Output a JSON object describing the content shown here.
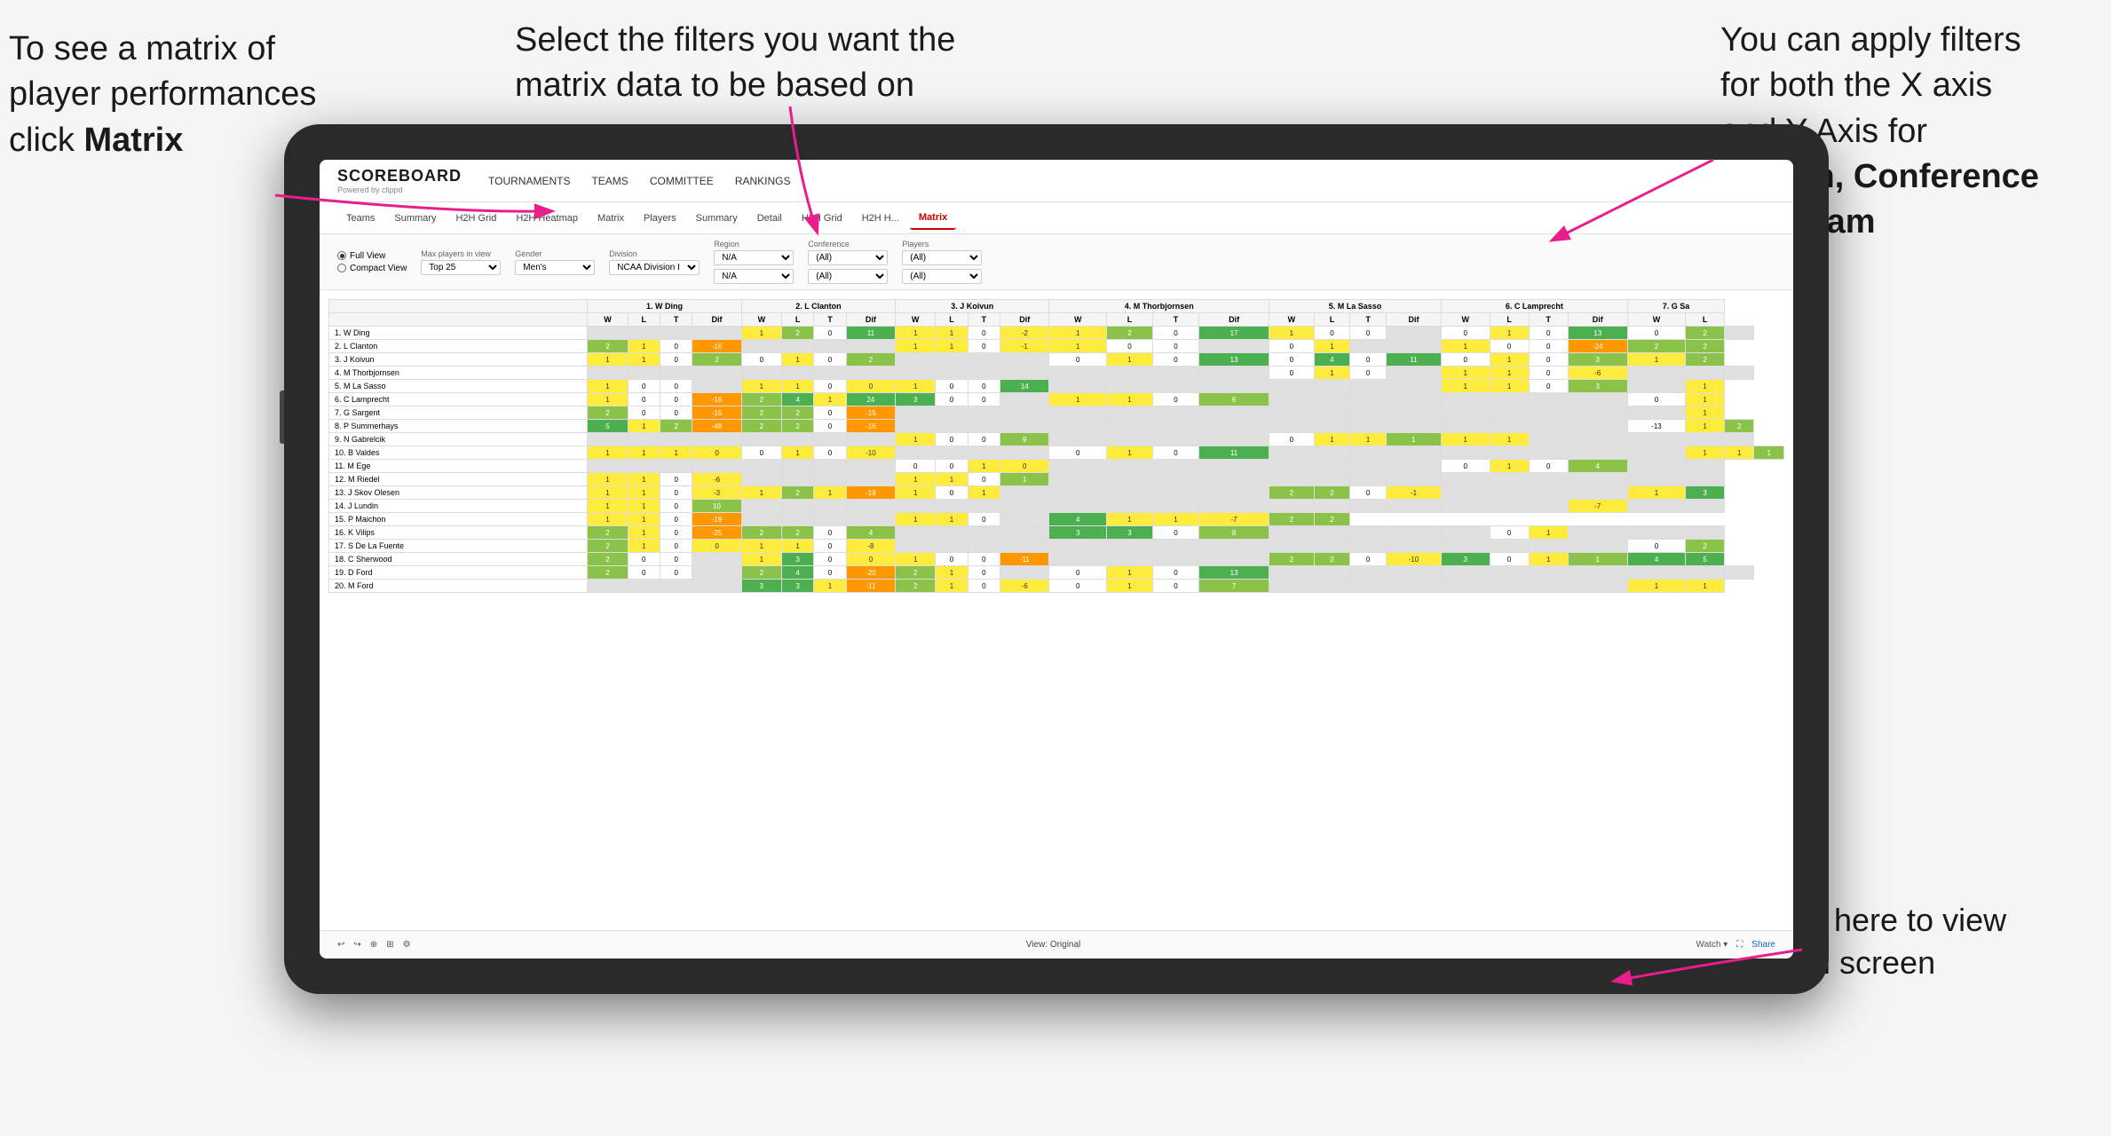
{
  "annotations": {
    "matrix_text": "To see a matrix of player performances click Matrix",
    "matrix_bold": "Matrix",
    "filters_text": "Select the filters you want the matrix data to be based on",
    "axes_text": "You  can apply filters for both the X axis and Y Axis for Region, Conference and Team",
    "axes_bold": "Region, Conference and Team",
    "fullscreen_text": "Click here to view in full screen"
  },
  "app": {
    "logo": "SCOREBOARD",
    "logo_sub": "Powered by clippd",
    "nav": [
      "TOURNAMENTS",
      "TEAMS",
      "COMMITTEE",
      "RANKINGS"
    ],
    "sub_nav": [
      "Teams",
      "Summary",
      "H2H Grid",
      "H2H Heatmap",
      "Matrix",
      "Players",
      "Summary",
      "Detail",
      "H2H Grid",
      "H2H H...",
      "Matrix"
    ],
    "active_tab": "Matrix"
  },
  "filters": {
    "view_full": "Full View",
    "view_compact": "Compact View",
    "max_players_label": "Max players in view",
    "max_players_value": "Top 25",
    "gender_label": "Gender",
    "gender_value": "Men's",
    "division_label": "Division",
    "division_value": "NCAA Division I",
    "region_label": "Region",
    "region_value": "N/A",
    "conference_label": "Conference",
    "conference_value": "(All)",
    "players_label": "Players",
    "players_value": "(All)"
  },
  "matrix": {
    "col_headers": [
      "1. W Ding",
      "2. L Clanton",
      "3. J Koivun",
      "4. M Thorbjornsen",
      "5. M La Sasso",
      "6. C Lamprecht",
      "7. G Sa"
    ],
    "sub_headers": [
      "W",
      "L",
      "T",
      "Dif"
    ],
    "rows": [
      {
        "name": "1. W Ding",
        "cells": [
          "",
          "",
          "",
          "",
          "1",
          "2",
          "0",
          "11",
          "1",
          "1",
          "0",
          "-2",
          "1",
          "2",
          "0",
          "17",
          "1",
          "0",
          "0",
          "",
          "0",
          "1",
          "0",
          "13",
          "0",
          "2",
          ""
        ]
      },
      {
        "name": "2. L Clanton",
        "cells": [
          "2",
          "1",
          "0",
          "-16",
          "",
          "",
          "",
          "",
          "1",
          "1",
          "0",
          "-1",
          "1",
          "0",
          "0",
          "",
          "0",
          "1",
          "",
          "",
          "1",
          "0",
          "0",
          "-24",
          "2",
          "2"
        ]
      },
      {
        "name": "3. J Koivun",
        "cells": [
          "1",
          "1",
          "0",
          "2",
          "0",
          "1",
          "0",
          "2",
          "",
          "",
          "",
          "",
          "0",
          "1",
          "0",
          "13",
          "0",
          "4",
          "0",
          "11",
          "0",
          "1",
          "0",
          "3",
          "1",
          "2"
        ]
      },
      {
        "name": "4. M Thorbjornsen",
        "cells": [
          "",
          "",
          "",
          "",
          "",
          "",
          "",
          "",
          "",
          "",
          "",
          "",
          "",
          "",
          "",
          "",
          "0",
          "1",
          "0",
          "",
          "1",
          "1",
          "0",
          "-6",
          "",
          "",
          ""
        ]
      },
      {
        "name": "5. M La Sasso",
        "cells": [
          "1",
          "0",
          "0",
          "",
          "1",
          "1",
          "0",
          "0",
          "1",
          "0",
          "0",
          "14",
          "",
          "",
          "",
          "",
          "",
          "",
          "",
          "",
          "1",
          "1",
          "0",
          "3",
          "",
          "1"
        ]
      },
      {
        "name": "6. C Lamprecht",
        "cells": [
          "1",
          "0",
          "0",
          "-16",
          "2",
          "4",
          "1",
          "24",
          "3",
          "0",
          "0",
          "",
          "1",
          "1",
          "0",
          "6",
          "",
          "",
          "",
          "",
          "",
          "",
          "",
          "",
          "0",
          "1"
        ]
      },
      {
        "name": "7. G Sargent",
        "cells": [
          "2",
          "0",
          "0",
          "-16",
          "2",
          "2",
          "0",
          "-15",
          "",
          "",
          "",
          "",
          "",
          "",
          "",
          "",
          "",
          "",
          "",
          "",
          "",
          "",
          "",
          "",
          "",
          "1"
        ]
      },
      {
        "name": "8. P Summerhays",
        "cells": [
          "5",
          "1",
          "2",
          "-48",
          "2",
          "2",
          "0",
          "-16",
          "",
          "",
          "",
          "",
          "",
          "",
          "",
          "",
          "",
          "",
          "",
          "",
          "",
          "",
          "",
          "",
          "-13",
          "1",
          "2"
        ]
      },
      {
        "name": "9. N Gabrelcik",
        "cells": [
          "",
          "",
          "",
          "",
          "",
          "",
          "",
          "",
          "1",
          "0",
          "0",
          "9",
          "",
          "",
          "",
          "",
          "0",
          "1",
          "1",
          "1",
          "1",
          "1",
          "",
          "",
          "",
          "",
          ""
        ]
      },
      {
        "name": "10. B Valdes",
        "cells": [
          "1",
          "1",
          "1",
          "0",
          "0",
          "1",
          "0",
          "-10",
          "",
          "",
          "",
          "",
          "0",
          "1",
          "0",
          "11",
          "",
          "",
          "",
          "",
          "",
          "",
          "",
          "",
          "",
          "1",
          "1",
          "1"
        ]
      },
      {
        "name": "11. M Ege",
        "cells": [
          "",
          "",
          "",
          "",
          "",
          "",
          "",
          "",
          "0",
          "0",
          "1",
          "0",
          "",
          "",
          "",
          "",
          "",
          "",
          "",
          "",
          "0",
          "1",
          "0",
          "4",
          "",
          ""
        ]
      },
      {
        "name": "12. M Riedel",
        "cells": [
          "1",
          "1",
          "0",
          "-6",
          "",
          "",
          "",
          "",
          "1",
          "1",
          "0",
          "1",
          "",
          "",
          "",
          "",
          "",
          "",
          "",
          "",
          "",
          "",
          "",
          "",
          "",
          ""
        ]
      },
      {
        "name": "13. J Skov Olesen",
        "cells": [
          "1",
          "1",
          "0",
          "-3",
          "1",
          "2",
          "1",
          "-19",
          "1",
          "0",
          "1",
          "",
          "",
          "",
          "",
          "",
          "2",
          "2",
          "0",
          "-1",
          "",
          "",
          "",
          "",
          "1",
          "3"
        ]
      },
      {
        "name": "14. J Lundin",
        "cells": [
          "1",
          "1",
          "0",
          "10",
          "",
          "",
          "",
          "",
          "",
          "",
          "",
          "",
          "",
          "",
          "",
          "",
          "",
          "",
          "",
          "",
          "",
          "",
          "",
          "-7",
          "",
          ""
        ]
      },
      {
        "name": "15. P Maichon",
        "cells": [
          "1",
          "1",
          "0",
          "-19",
          "",
          "",
          "",
          "",
          "1",
          "1",
          "0",
          "",
          "4",
          "1",
          "1",
          "-7",
          "2",
          "2"
        ]
      },
      {
        "name": "16. K Vilips",
        "cells": [
          "2",
          "1",
          "0",
          "-25",
          "2",
          "2",
          "0",
          "4",
          "",
          "",
          "",
          "",
          "3",
          "3",
          "0",
          "8",
          "",
          "",
          "",
          "",
          "",
          "0",
          "1",
          "",
          "",
          ""
        ]
      },
      {
        "name": "17. S De La Fuente",
        "cells": [
          "2",
          "1",
          "0",
          "0",
          "1",
          "1",
          "0",
          "-8",
          "",
          "",
          "",
          "",
          "",
          "",
          "",
          "",
          "",
          "",
          "",
          "",
          "",
          "",
          "",
          "",
          "0",
          "2"
        ]
      },
      {
        "name": "18. C Sherwood",
        "cells": [
          "2",
          "0",
          "0",
          "",
          "1",
          "3",
          "0",
          "0",
          "1",
          "0",
          "0",
          "-11",
          "",
          "",
          "",
          "",
          "2",
          "2",
          "0",
          "-10",
          "3",
          "0",
          "1",
          "1",
          "4",
          "5"
        ]
      },
      {
        "name": "19. D Ford",
        "cells": [
          "2",
          "0",
          "0",
          "",
          "2",
          "4",
          "0",
          "-20",
          "2",
          "1",
          "0",
          "",
          "0",
          "1",
          "0",
          "13",
          "",
          "",
          "",
          "",
          "",
          "",
          "",
          "",
          "",
          "",
          ""
        ]
      },
      {
        "name": "20. M Ford",
        "cells": [
          "",
          "",
          "",
          "",
          "3",
          "3",
          "1",
          "-11",
          "2",
          "1",
          "0",
          "-6",
          "0",
          "1",
          "0",
          "7",
          "",
          "",
          "",
          "",
          "",
          "",
          "",
          "",
          "1",
          "1"
        ]
      }
    ]
  },
  "bottom_bar": {
    "view_label": "View: Original",
    "watch_label": "Watch",
    "share_label": "Share"
  },
  "colors": {
    "accent": "#cc0000",
    "arrow": "#e91e8c"
  }
}
